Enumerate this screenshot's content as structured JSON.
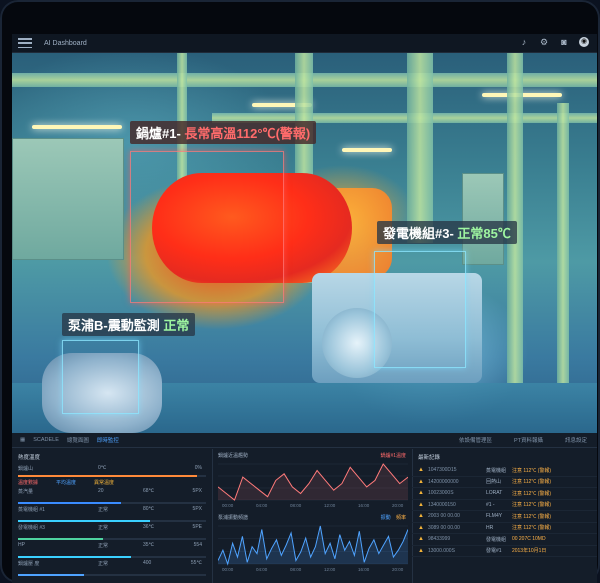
{
  "app": {
    "title": "AI Dashboard"
  },
  "scene": {
    "boiler_label": {
      "name": "鍋爐#1-",
      "status": "長常高溫112°℃(警報)"
    },
    "generator_label": {
      "name": "發電機組#3-",
      "status": "正常85℃"
    },
    "pump_label": {
      "name": "泵浦B-震動監測",
      "status": "正常"
    }
  },
  "tabs": {
    "items": [
      "SCADELE",
      "總覽面圖",
      "即時監控"
    ],
    "right": [
      "依設備管理區",
      "PT資料報攝",
      "訊息設定"
    ]
  },
  "sensors": {
    "title": "熱度溫度",
    "header": {
      "name": "鍋爐山",
      "mid": "0℃",
      "right": "0%"
    },
    "legend": [
      "溫度數據",
      "平均溫度",
      "異常溫度"
    ],
    "rows": [
      {
        "name": "蒸汽量",
        "mid": "20",
        "mid2": "68℃",
        "right": "5PX",
        "fill": 0.55,
        "color": "#3a8cff"
      },
      {
        "name": "蒸電機組 #1",
        "mid": "正常",
        "mid2": "80℃",
        "right": "5PX",
        "fill": 0.7,
        "color": "#3ad0ff"
      },
      {
        "name": "發電機組 #3",
        "mid": "正常",
        "mid2": "36℃",
        "right": "5PE",
        "fill": 0.45,
        "color": "#4fd3a0"
      },
      {
        "name": "HP",
        "mid": "正常",
        "mid2": "35℃",
        "right": "554",
        "fill": 0.6,
        "color": "#3ad0ff"
      },
      {
        "name": "鍋爐壓 度",
        "mid": "正常",
        "mid2": "400",
        "right": "55℃",
        "fill": 0.35,
        "color": "#4fa3ff"
      }
    ]
  },
  "trend": {
    "title": "鍋爐近溫趨勢",
    "legend": "鍋爐#1溫度",
    "ticks": [
      "00:00",
      "04:00",
      "08:00",
      "12:00",
      "16:00",
      "20:00"
    ],
    "values": [
      72,
      70,
      68,
      75,
      73,
      71,
      69,
      74,
      76,
      72,
      70,
      73,
      77,
      74,
      71,
      73,
      78,
      75,
      72,
      74,
      79,
      76,
      73,
      75
    ]
  },
  "vibration": {
    "title": "泵浦振動頻譜",
    "legend": [
      "振動",
      "頻率"
    ],
    "ticks": [
      "00:00",
      "04:00",
      "08:00",
      "12:00",
      "16:00",
      "20:00"
    ],
    "values": [
      12,
      18,
      10,
      22,
      14,
      26,
      11,
      20,
      16,
      30,
      13,
      19,
      24,
      15,
      21,
      28,
      12,
      17,
      25,
      14,
      20,
      32,
      16,
      22,
      13,
      27,
      18,
      23,
      15,
      29,
      11,
      19,
      24,
      16,
      21,
      26,
      14,
      18,
      23,
      30
    ]
  },
  "alarms": {
    "title": "最新記錄",
    "rows": [
      {
        "time": "1047300D15",
        "device": "蒸電機組",
        "status": "注意 112℃ (警報)"
      },
      {
        "time": "14200000000",
        "device": "回熱山",
        "status": "注意 112℃ (警報)"
      },
      {
        "time": "10023000S",
        "device": "LORAT",
        "status": "注意 112℃ (警報)"
      },
      {
        "time": "1340000150",
        "device": "#1 -",
        "status": "注意 112℃ (警報)"
      },
      {
        "time": "2003 00 00.00",
        "device": "FLM4Y",
        "status": "注意 112℃ (警報)"
      },
      {
        "time": "3089 00 00.00",
        "device": "HR",
        "status": "注意 112℃ (警報)"
      },
      {
        "time": "98433999",
        "device": "發電機組",
        "status": "00 207C 10MD"
      },
      {
        "time": "13000.000S",
        "device": "發電#1",
        "status": "2013年10月1日"
      }
    ]
  }
}
